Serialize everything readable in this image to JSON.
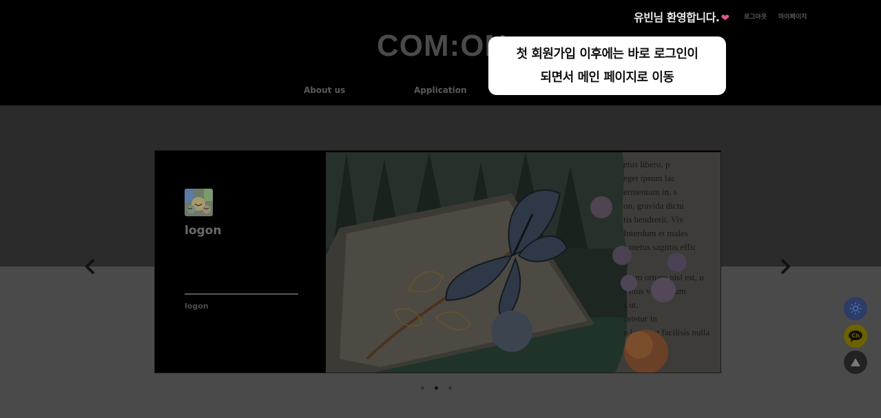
{
  "header": {
    "welcome": "유빈님 환영합니다.",
    "heart_icon": "heart-icon",
    "logout": "로그아웃",
    "mypage": "마이페이지",
    "logo": "COM:ON",
    "nav": [
      "About us",
      "Application"
    ]
  },
  "tooltip": {
    "line1": "첫 회원가입 이후에는 바로 로그인이",
    "line2": "되면서 메인 페이지로 이동"
  },
  "slider": {
    "title": "logon",
    "subtitle": "logon",
    "prev_icon": "chevron-left-icon",
    "next_icon": "chevron-right-icon",
    "dots": 3,
    "active_dot": 2
  },
  "floating": {
    "theme_icon": "sun-icon",
    "chat_label": "Ch",
    "top_icon": "arrow-up-icon"
  },
  "colors": {
    "tooltip_bg": "#ffffff",
    "header_bg": "#000000",
    "heart": "#e0568e"
  }
}
